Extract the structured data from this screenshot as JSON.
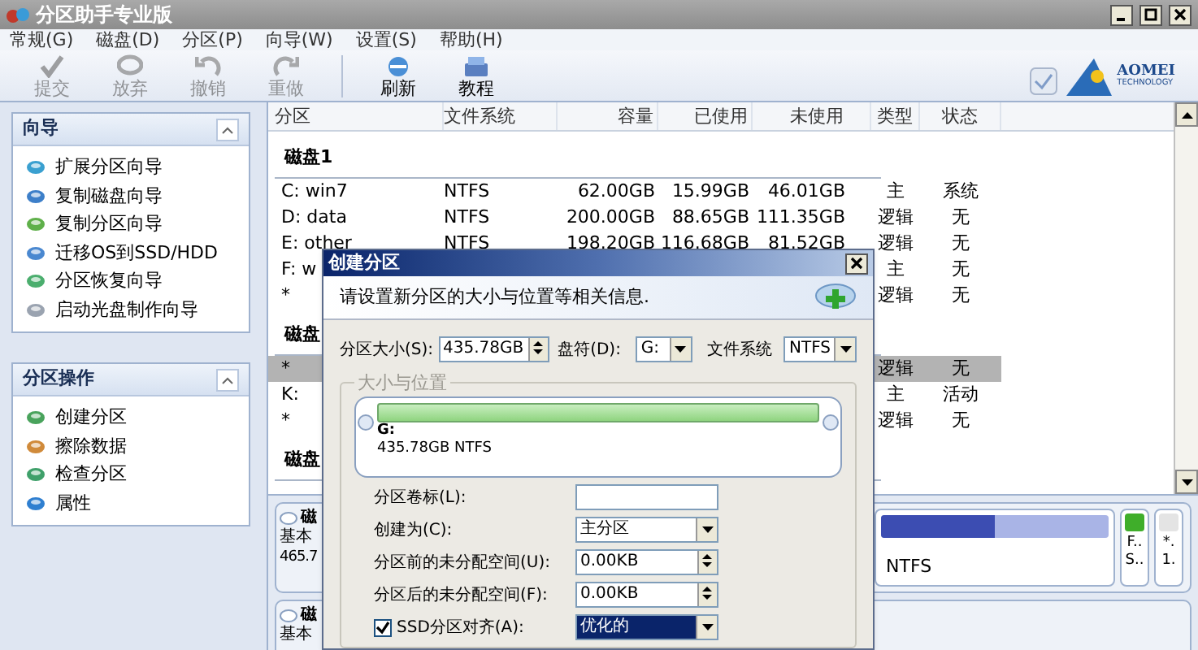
{
  "window": {
    "title": "分区助手专业版"
  },
  "menu": [
    "常规(G)",
    "磁盘(D)",
    "分区(P)",
    "向导(W)",
    "设置(S)",
    "帮助(H)"
  ],
  "toolbar": [
    {
      "label": "提交",
      "disabled": true
    },
    {
      "label": "放弃",
      "disabled": true
    },
    {
      "label": "撤销",
      "disabled": true
    },
    {
      "label": "重做",
      "disabled": true
    },
    {
      "label": "刷新",
      "disabled": false
    },
    {
      "label": "教程",
      "disabled": false
    }
  ],
  "logo": {
    "name": "AOMEI",
    "tagline": "TECHNOLOGY"
  },
  "sidebar": {
    "panels": [
      {
        "title": "向导",
        "items": [
          "扩展分区向导",
          "复制磁盘向导",
          "复制分区向导",
          "迁移OS到SSD/HDD",
          "分区恢复向导",
          "启动光盘制作向导"
        ]
      },
      {
        "title": "分区操作",
        "items": [
          "创建分区",
          "擦除数据",
          "检查分区",
          "属性"
        ]
      }
    ]
  },
  "table": {
    "columns": [
      "分区",
      "文件系统",
      "容量",
      "已使用",
      "未使用",
      "类型",
      "状态"
    ],
    "rows": [
      {
        "kind": "disk",
        "label": "磁盘1"
      },
      {
        "kind": "partition",
        "selected": false,
        "partition": "C: win7",
        "file_system": "NTFS",
        "capacity": "62.00GB",
        "used": "15.99GB",
        "free": "46.01GB",
        "type": "主",
        "status": "系统"
      },
      {
        "kind": "partition",
        "selected": false,
        "partition": "D: data",
        "file_system": "NTFS",
        "capacity": "200.00GB",
        "used": "88.65GB",
        "free": "111.35GB",
        "type": "逻辑",
        "status": "无"
      },
      {
        "kind": "partition",
        "selected": false,
        "partition": "E: other",
        "file_system": "NTFS",
        "capacity": "198.20GB",
        "used": "116.68GB",
        "free": "81.52GB",
        "type": "逻辑",
        "status": "无"
      },
      {
        "kind": "partition",
        "selected": false,
        "partition": "F: w",
        "type": "主",
        "status": "无"
      },
      {
        "kind": "partition",
        "selected": false,
        "partition": "*",
        "type": "逻辑",
        "status": "无"
      },
      {
        "kind": "disk",
        "label": "磁盘"
      },
      {
        "kind": "partition",
        "selected": true,
        "partition": "*",
        "type": "逻辑",
        "status": "无"
      },
      {
        "kind": "partition",
        "selected": false,
        "partition": "K:",
        "type": "主",
        "status": "活动"
      },
      {
        "kind": "partition",
        "selected": false,
        "partition": "*",
        "type": "逻辑",
        "status": "无"
      },
      {
        "kind": "disk",
        "label": "磁盘"
      }
    ]
  },
  "disk_map": [
    {
      "title": "磁",
      "type": "基本",
      "size": "465.7",
      "bar_label": "NTFS",
      "level": 0.5,
      "small_partitions": [
        {
          "line_1": "F..",
          "line_2": "S..",
          "color": "#3fae2a"
        },
        {
          "line_1": "*.",
          "line_2": "1.",
          "color": "#e4e4e4"
        }
      ]
    },
    {
      "title": "磁",
      "type": "基本"
    }
  ],
  "dialog": {
    "title": "创建分区",
    "description": "请设置新分区的大小与位置等相关信息.",
    "size_label": "分区大小(S):",
    "size_value": "435.78GB",
    "letter_label": "盘符(D):",
    "letter_value": "G:",
    "fs_label": "文件系统",
    "fs_value": "NTFS",
    "group_title": "大小与位置",
    "partition_letter": "G:",
    "partition_info": "435.78GB NTFS",
    "fields": [
      {
        "kind": "text",
        "label": "分区卷标(L):"
      },
      {
        "kind": "select",
        "label": "创建为(C):",
        "value": "主分区"
      },
      {
        "kind": "spin",
        "label": "分区前的未分配空间(U):",
        "value": "0.00KB"
      },
      {
        "kind": "spin",
        "label": "分区后的未分配空间(F):",
        "value": "0.00KB"
      },
      {
        "kind": "check_select",
        "label": "SSD分区对齐(A):",
        "checked": true,
        "value": "优化的"
      }
    ]
  }
}
